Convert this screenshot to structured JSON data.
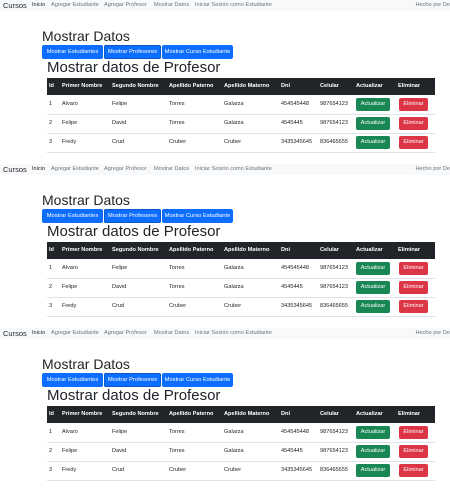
{
  "navbar": {
    "brand": "Cursos",
    "links": [
      "Inicio",
      "Agregar Estudiante",
      "Agregar Profesor",
      "Mostrar Datos",
      "Iniciar Sesión como Estudiante"
    ],
    "right_text": "Hecho por De"
  },
  "page": {
    "title": "Mostrar Datos",
    "buttons": [
      "Mostrar Estudiantes",
      "Mostrar Profesores",
      "Mostrar Curso Estudiante"
    ],
    "subtitle": "Mostrar datos de Profesor"
  },
  "table": {
    "headers": [
      "Id",
      "Primer Nombre",
      "Segundo Nombre",
      "Apellido Paterno",
      "Apellido Materno",
      "Dni",
      "Celular",
      "Actualizar",
      "Eliminar"
    ],
    "rows": [
      [
        "1",
        "Alvaro",
        "Felipe",
        "Torres",
        "Galarza",
        "454545448",
        "987654123"
      ],
      [
        "2",
        "Felipe",
        "David",
        "Torres",
        "Galarza",
        "4545445",
        "987654123"
      ],
      [
        "3",
        "Fredy",
        "Crud",
        "Cruber",
        "Cruber",
        "3435345645",
        "836465655"
      ]
    ],
    "update_label": "Actualizar",
    "delete_label": "Eliminar"
  },
  "colors": {
    "primary": "#0d6efd",
    "success": "#198754",
    "danger": "#dc3545",
    "dark": "#212529",
    "navbar_bg": "#f8f9fa"
  }
}
